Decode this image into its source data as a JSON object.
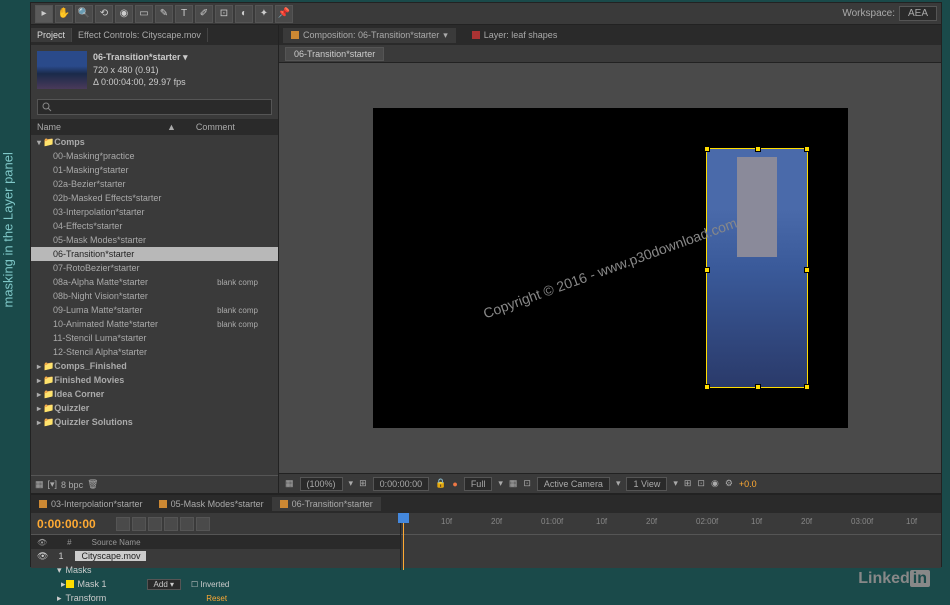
{
  "sidebar_label": "masking in the Layer panel",
  "workspace": {
    "label": "Workspace:",
    "value": "AEA"
  },
  "panels": {
    "project_tab": "Project",
    "effects_tab": "Effect Controls: Cityscape.mov"
  },
  "comp_info": {
    "name": "06-Transition*starter ▾",
    "dimensions": "720 x 480 (0.91)",
    "duration": "Δ 0:00:04:00, 29.97 fps"
  },
  "project_columns": {
    "name": "Name",
    "comment": "Comment"
  },
  "tree": {
    "folder1": "Comps",
    "items": [
      {
        "label": "00-Masking*practice",
        "comment": ""
      },
      {
        "label": "01-Masking*starter",
        "comment": ""
      },
      {
        "label": "02a-Bezier*starter",
        "comment": ""
      },
      {
        "label": "02b-Masked Effects*starter",
        "comment": ""
      },
      {
        "label": "03-Interpolation*starter",
        "comment": ""
      },
      {
        "label": "04-Effects*starter",
        "comment": ""
      },
      {
        "label": "05-Mask Modes*starter",
        "comment": ""
      },
      {
        "label": "06-Transition*starter",
        "comment": ""
      },
      {
        "label": "07-RotoBezier*starter",
        "comment": ""
      },
      {
        "label": "08a-Alpha Matte*starter",
        "comment": "blank comp"
      },
      {
        "label": "08b-Night Vision*starter",
        "comment": ""
      },
      {
        "label": "09-Luma Matte*starter",
        "comment": "blank comp"
      },
      {
        "label": "10-Animated Matte*starter",
        "comment": "blank comp"
      },
      {
        "label": "11-Stencil Luma*starter",
        "comment": ""
      },
      {
        "label": "12-Stencil Alpha*starter",
        "comment": ""
      }
    ],
    "folder2": "Comps_Finished",
    "folder3": "Finished Movies",
    "folder4": "Idea Corner",
    "folder5": "Quizzler",
    "folder6": "Quizzler Solutions"
  },
  "footer": {
    "bpc": "8 bpc"
  },
  "comp_viewer": {
    "composition_label": "Composition: 06-Transition*starter",
    "layer_label": "Layer: leaf shapes",
    "breadcrumb": "06-Transition*starter"
  },
  "viewer_controls": {
    "zoom": "(100%)",
    "time": "0:00:00:00",
    "res": "Full",
    "camera": "Active Camera",
    "views": "1 View",
    "exposure": "+0.0"
  },
  "timeline": {
    "tab1": "03-Interpolation*starter",
    "tab2": "05-Mask Modes*starter",
    "tab3": "06-Transition*starter",
    "timecode": "0:00:00:00",
    "col_num": "#",
    "col_source": "Source Name",
    "layer_num": "1",
    "layer_name": "Cityscape.mov",
    "masks_label": "Masks",
    "mask1_label": "Mask 1",
    "mask_mode": "Add",
    "inverted": "Inverted",
    "transform_label": "Transform",
    "reset": "Reset",
    "ruler": [
      "10f",
      "20f",
      "01:00f",
      "10f",
      "20f",
      "02:00f",
      "10f",
      "20f",
      "03:00f",
      "10f"
    ]
  },
  "watermark": "Copyright © 2016 - www.p30download.com",
  "logo": {
    "text": "Linked",
    "suffix": "in"
  }
}
